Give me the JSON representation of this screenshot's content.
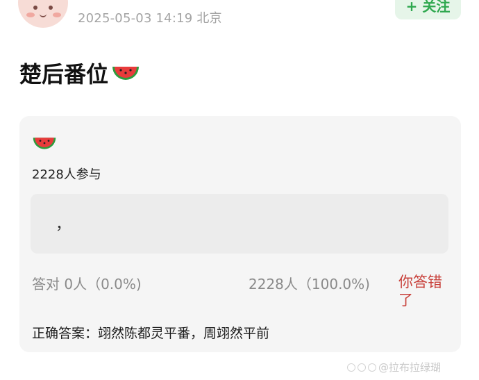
{
  "post": {
    "meta": "2025-05-03 14:19  北京",
    "follow_label": "+ 关注",
    "title": "楚后番位",
    "title_emoji_icon": "watermelon-icon"
  },
  "poll": {
    "emoji_icon": "watermelon-icon",
    "participants": "2228人参与",
    "answer": "，",
    "correct_stat": "答对  0人（0.0%)",
    "wrong_stat": "2228人（100.0%)",
    "result": "你答错了",
    "correct_answer": "正确答案：翊然陈都灵平番，周翊然平前",
    "correct_fraction": 0.0,
    "wrong_fraction": 1.0
  },
  "watermark": "@拉布拉绿瑚",
  "colors": {
    "accent_green": "#2fa84f",
    "error_red": "#c8403a",
    "card_bg": "#f5f5f5"
  }
}
